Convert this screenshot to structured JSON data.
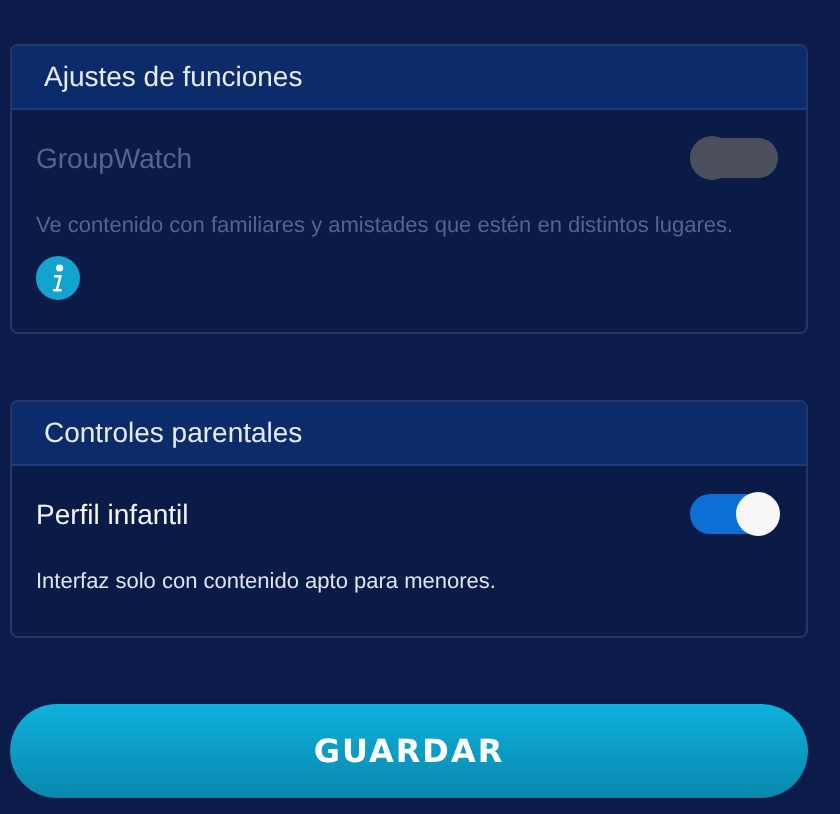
{
  "sections": [
    {
      "title": "Ajustes de funciones",
      "settings": [
        {
          "name": "GroupWatch",
          "description": "Ve contenido con familiares y amistades que estén en distintos lugares.",
          "info": true,
          "on": false,
          "disabled": true
        }
      ]
    },
    {
      "title": "Controles parentales",
      "settings": [
        {
          "name": "Perfil infantil",
          "description": "Interfaz solo con contenido apto para menores.",
          "info": false,
          "on": true,
          "disabled": false
        }
      ]
    }
  ],
  "save_button": "GUARDAR"
}
